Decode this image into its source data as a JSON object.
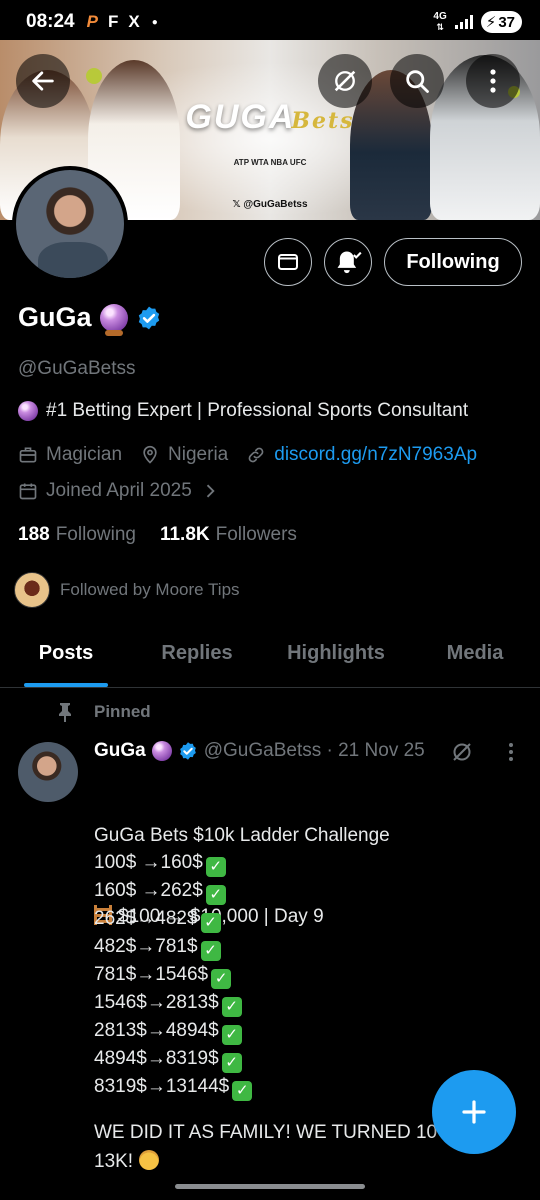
{
  "status_bar": {
    "time": "08:24",
    "app_icons": [
      "P",
      "F",
      "X"
    ],
    "network": "4G",
    "battery": "37"
  },
  "banner": {
    "logo_main": "GUGA",
    "logo_script": "Bets",
    "sponsors": "ATP WTA NBA UFC",
    "handle": "@GuGaBetss"
  },
  "header_actions": {
    "back_icon": "arrow-left-icon",
    "grok_icon": "grok-icon",
    "search_icon": "search-icon",
    "more_icon": "more-vertical-icon"
  },
  "profile": {
    "name": "GuGa",
    "handle": "@GuGaBetss",
    "bio": "#1 Betting Expert | Professional Sports Consultant",
    "profession": "Magician",
    "location": "Nigeria",
    "link": "discord.gg/n7zN7963Ap",
    "joined": "Joined April 2025",
    "following_count": "188",
    "following_label": "Following",
    "followers_count": "11.8K",
    "followers_label": "Followers",
    "followed_by": "Followed by Moore Tips",
    "follow_button": "Following"
  },
  "tabs": [
    {
      "label": "Posts",
      "active": true
    },
    {
      "label": "Replies",
      "active": false
    },
    {
      "label": "Highlights",
      "active": false
    },
    {
      "label": "Media",
      "active": false
    }
  ],
  "pinned_post": {
    "pinned_label": "Pinned",
    "author": "GuGa",
    "handle_date": "@GuGaBetss · 21 Nov 25",
    "title": "GuGa Bets $10k Ladder Challenge",
    "subtitle": "$100 → $10,000 | Day 9",
    "lines": [
      "100$ →160$",
      "160$ →262$",
      "262$→482$",
      "482$→781$",
      "781$→1546$",
      "1546$→2813$",
      "2813$→4894$",
      "4894$→8319$",
      "8319$→13144$"
    ],
    "footer": "WE DID IT AS FAMILY! WE TURNED 10 13K!"
  },
  "colors": {
    "accent": "#1d9bf0",
    "muted": "#71767b",
    "background": "#000000"
  }
}
